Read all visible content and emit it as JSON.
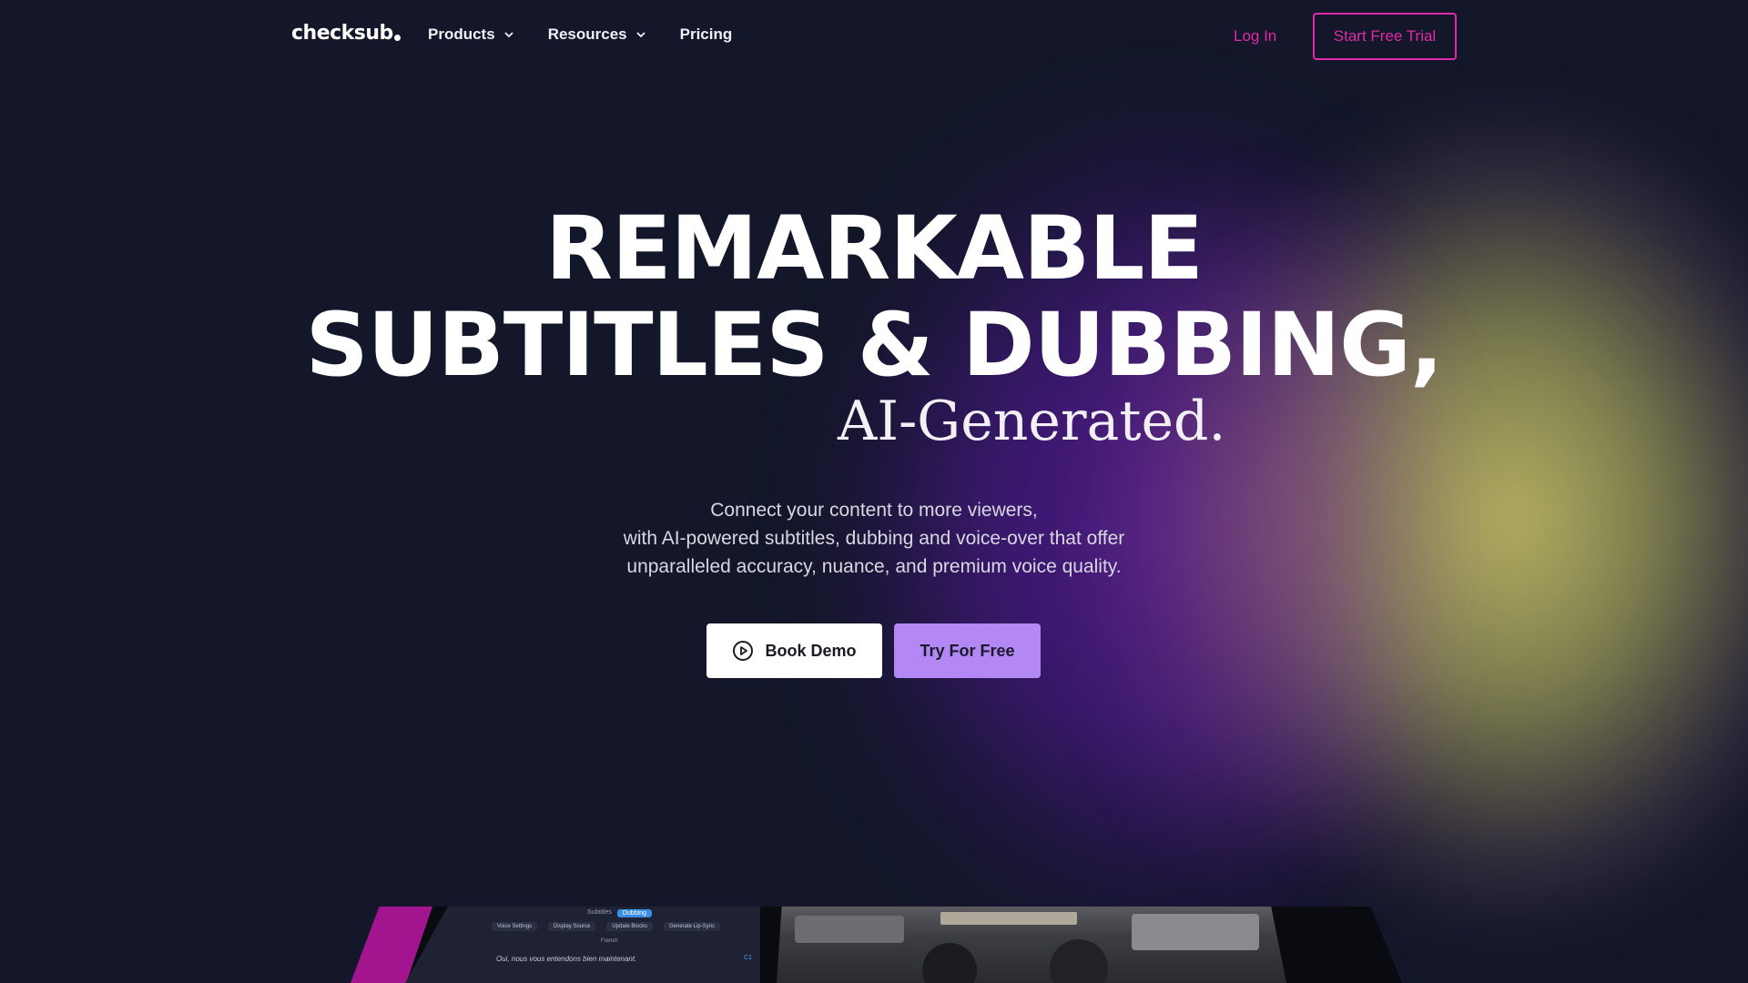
{
  "header": {
    "logo": "checksub",
    "nav": [
      {
        "label": "Products",
        "has_dropdown": true
      },
      {
        "label": "Resources",
        "has_dropdown": true
      },
      {
        "label": "Pricing",
        "has_dropdown": false
      }
    ],
    "login_label": "Log In",
    "trial_label": "Start Free Trial"
  },
  "hero": {
    "title_line1": "REMARKABLE",
    "title_line2": "SUBTITLES & DUBBING,",
    "title_script": "AI-Generated.",
    "subtitle_line1": "Connect your content to more viewers,",
    "subtitle_line2": "with AI-powered subtitles, dubbing and voice-over that offer",
    "subtitle_line3": "unparalleled accuracy, nuance, and premium voice quality."
  },
  "cta": {
    "demo_label": "Book Demo",
    "try_label": "Try For Free"
  },
  "preview": {
    "tabs": [
      "Subtitles",
      "Dubbing"
    ],
    "toolbar": [
      "Voice Settings",
      "Display Source",
      "Update Blocks",
      "Generate Lip-Sync"
    ],
    "language": "French",
    "line": "Oui, nous vous entendons bien maintenant.",
    "tag": "C1"
  },
  "colors": {
    "accent_pink": "#e02aa8",
    "accent_purple": "#b388f5",
    "background": "#131729"
  }
}
